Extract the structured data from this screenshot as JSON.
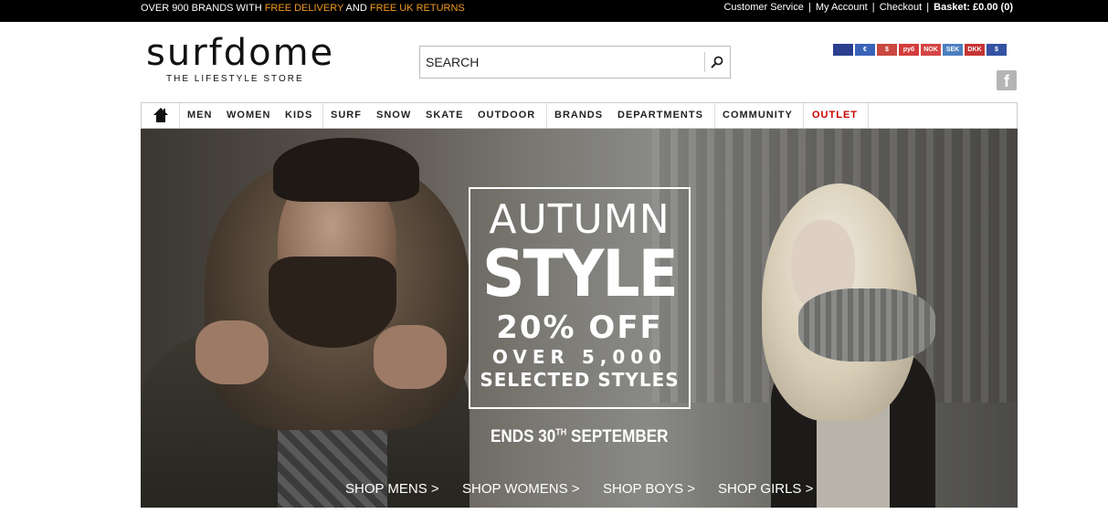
{
  "topbar": {
    "promo_prefix": "OVER 900 BRANDS WITH ",
    "promo_free_delivery": "FREE DELIVERY",
    "promo_and": " AND ",
    "promo_free_returns": "FREE UK RETURNS",
    "customer_service": "Customer Service",
    "my_account": "My Account",
    "checkout": "Checkout",
    "basket": "Basket: £0.00 (0)",
    "separator": "|"
  },
  "logo": {
    "wordmark": "surfdome",
    "tagline": "THE LIFESTYLE STORE"
  },
  "search": {
    "placeholder": "SEARCH"
  },
  "currencies": [
    {
      "code": "GBP",
      "label": "",
      "color": "#2a3f8f"
    },
    {
      "code": "EUR",
      "label": "€",
      "color": "#3a63b8"
    },
    {
      "code": "USD",
      "label": "$",
      "color": "#c9483f"
    },
    {
      "code": "RUB",
      "label": "руб",
      "color": "#d43c3c"
    },
    {
      "code": "NOK",
      "label": "NOK",
      "color": "#d44545"
    },
    {
      "code": "SEK",
      "label": "SEK",
      "color": "#4c7fc0"
    },
    {
      "code": "DKK",
      "label": "DKK",
      "color": "#c63434"
    },
    {
      "code": "AUD",
      "label": "$",
      "color": "#3552a3"
    }
  ],
  "nav": {
    "men": "MEN",
    "women": "WOMEN",
    "kids": "KIDS",
    "surf": "SURF",
    "snow": "SNOW",
    "skate": "SKATE",
    "outdoor": "OUTDOOR",
    "brands": "BRANDS",
    "departments": "DEPARTMENTS",
    "community": "COMMUNITY",
    "outlet": "OUTLET"
  },
  "hero": {
    "line1": "AUTUMN",
    "line2": "STYLE",
    "line3": "20% OFF",
    "line4": "OVER 5,000",
    "line5": "SELECTED STYLES",
    "ends_prefix": "ENDS 30",
    "ends_sup": "TH",
    "ends_suffix": " SEPTEMBER",
    "shop_mens": "SHOP MENS >",
    "shop_womens": "SHOP WOMENS >",
    "shop_boys": "SHOP BOYS >",
    "shop_girls": "SHOP GIRLS >"
  }
}
